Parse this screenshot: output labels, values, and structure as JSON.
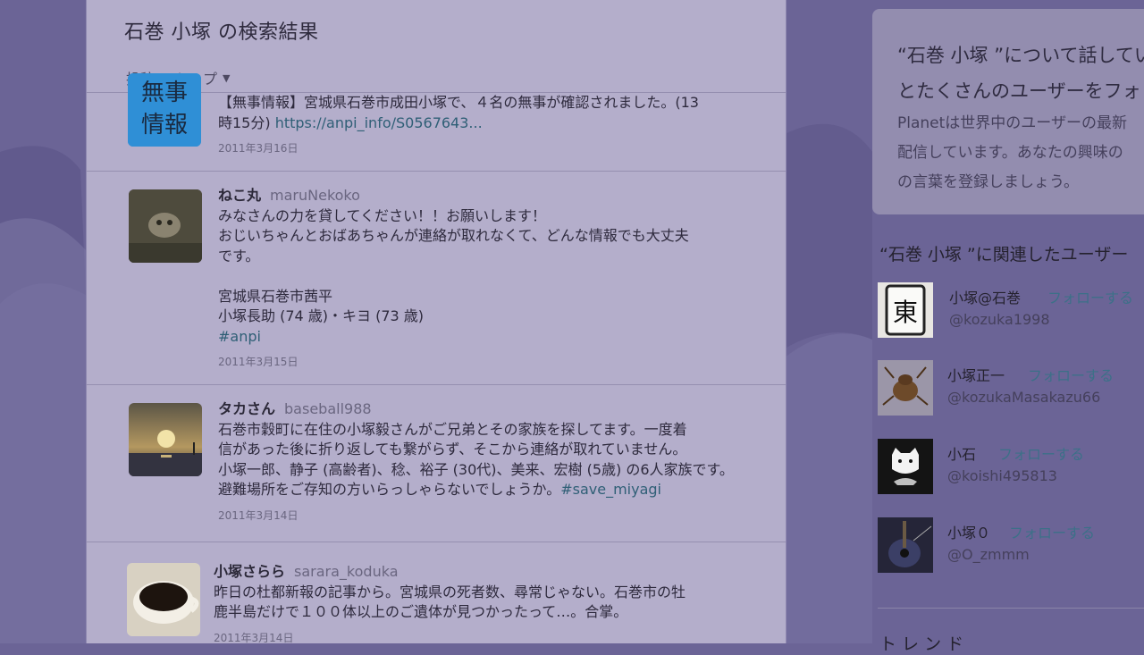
{
  "search": {
    "title": "石巻 小塚 の検索結果",
    "tabs": {
      "posts": "投稿",
      "top": "トップ"
    }
  },
  "tweets": [
    {
      "name": "",
      "handle": "",
      "avatar_text": "無事\n情報",
      "text": "【無事情報】宮城県石巻市成田小塚で、４名の無事が確認されました。(13\n時15分) ",
      "link": "https://anpi_info/S0567643...",
      "after": "",
      "date": "2011年3月16日"
    },
    {
      "name": "ねこ丸",
      "handle": "maruNekoko",
      "text": "みなさんの力を貸してください！！お願いします！\nおじいちゃんとおばあちゃんが連絡が取れなくて、どんな情報でも大丈夫\nです。\n\n宮城県石巻市茜平\n小塚長助 (74 歳)・キヨ (73 歳)\n",
      "link": "#anpi",
      "after": "",
      "date": "2011年3月15日"
    },
    {
      "name": "タカさん",
      "handle": "baseball988",
      "text": "石巻市穀町に在住の小塚毅さんがご兄弟とその家族を探してます。一度着\n信があった後に折り返しても繋がらず、そこから連絡が取れていません。\n小塚一郎、静子 (高齢者)、稔、裕子 (30代)、美来、宏樹 (5歳) の6人家族です。\n避難場所をご存知の方いらっしゃらないでしょうか。",
      "link": "#save_miyagi",
      "after": "",
      "date": "2011年3月14日"
    },
    {
      "name": "小塚さらら",
      "handle": "sarara_koduka",
      "text": "昨日の杜都新報の記事から。宮城県の死者数、尋常じゃない。石巻市の牡\n鹿半島だけで１００体以上のご遺体が見つかったって…。合掌。",
      "link": "",
      "after": "",
      "date": "2011年3月14日"
    }
  ],
  "planet_card": {
    "line1": "“石巻 小塚 ”について話してい",
    "line2": "とたくさんのユーザーをフォ",
    "line3": "Planetは世界中のユーザーの最新",
    "line4": "配信しています。あなたの興味の",
    "line5": "の言葉を登録しましょう。"
  },
  "related": {
    "title": "“石巻 小塚 ”に関連したユーザー",
    "follow_label": "フォローする",
    "users": [
      {
        "name": "小塚@石巻",
        "handle": "@kozuka1998"
      },
      {
        "name": "小塚正一",
        "handle": "@kozukaMasakazu66"
      },
      {
        "name": "小石",
        "handle": "@koishi495813"
      },
      {
        "name": "小塚０",
        "handle": "@O_zmmm"
      }
    ]
  },
  "bottom_partial": "ト レ ン ド",
  "colors": {
    "link": "#2f5f76",
    "follow": "#3c7088",
    "background": "#6b6496",
    "panel": "#b4aecb"
  }
}
